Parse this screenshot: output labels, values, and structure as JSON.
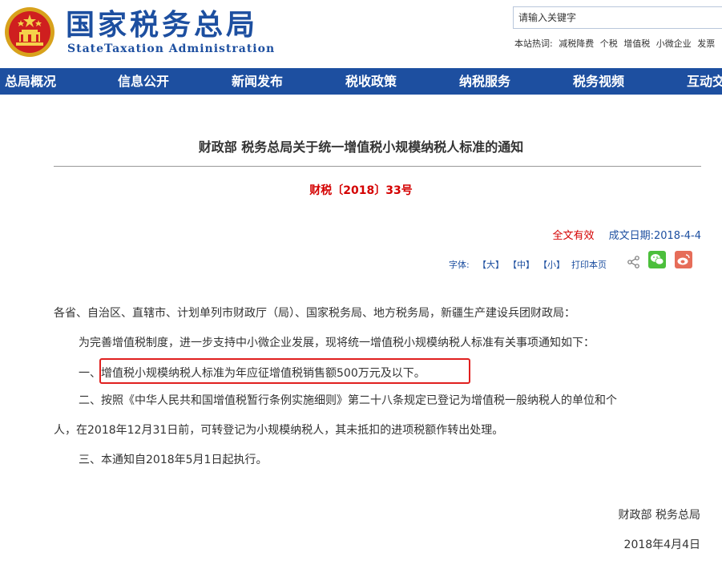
{
  "header": {
    "logo_cn": "国家税务总局",
    "logo_en": "StateTaxation Administration",
    "search_placeholder": "请输入关键字",
    "hot_label": "本站热词:",
    "hot_words": [
      "减税降费",
      "个税",
      "增值税",
      "小微企业",
      "发票"
    ]
  },
  "nav": {
    "items": [
      "总局概况",
      "信息公开",
      "新闻发布",
      "税收政策",
      "纳税服务",
      "税务视频",
      "互动交流"
    ]
  },
  "article": {
    "title": "财政部 税务总局关于统一增值税小规模纳税人标准的通知",
    "doc_number": "财税〔2018〕33号",
    "status": "全文有效",
    "issue_date": "成文日期:2018-4-4",
    "tools": {
      "font_label": "字体:",
      "large": "【大】",
      "medium": "【中】",
      "small": "【小】",
      "print": "打印本页"
    },
    "paragraphs": [
      "各省、自治区、直辖市、计划单列市财政厅（局）、国家税务局、地方税务局，新疆生产建设兵团财政局：",
      "为完善增值税制度，进一步支持中小微企业发展，现将统一增值税小规模纳税人标准有关事项通知如下：",
      "一、增值税小规模纳税人标准为年应征增值税销售额500万元及以下。",
      "二、按照《中华人民共和国增值税暂行条例实施细则》第二十八条规定已登记为增值税一般纳税人的单位和个",
      "人，在2018年12月31日前，可转登记为小规模纳税人，其未抵扣的进项税额作转出处理。",
      "三、本通知自2018年5月1日起执行。"
    ],
    "signature": "财政部 税务总局",
    "sign_date": "2018年4月4日"
  }
}
